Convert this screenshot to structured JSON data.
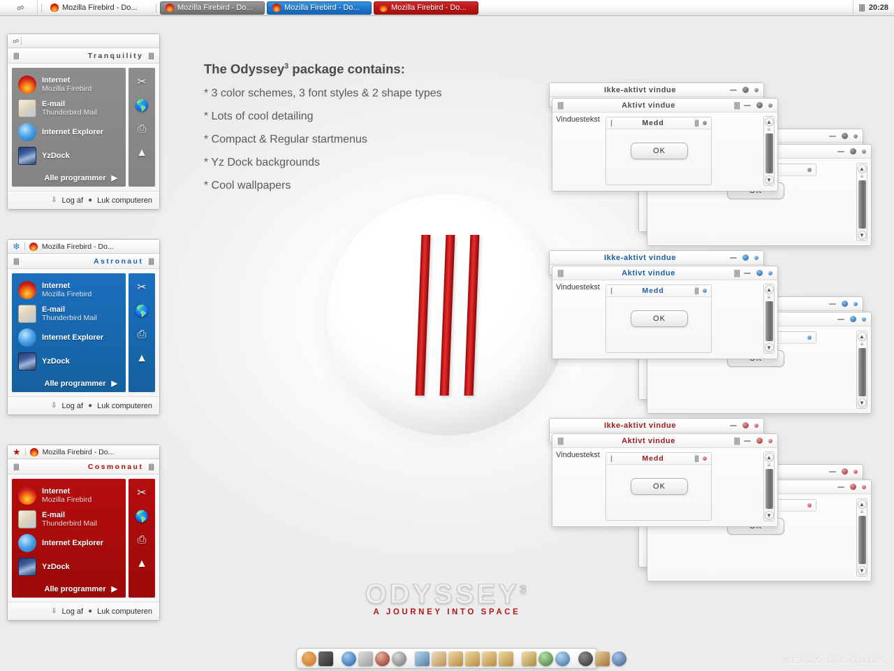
{
  "taskbar": {
    "start_icon": "infinity-icon",
    "tasks": [
      {
        "label": "Mozilla Firebird - Do...",
        "style": "plain",
        "icon": "firebird-icon"
      },
      {
        "label": "Mozilla Firebird - Do...",
        "style": "grey",
        "icon": "firebird-icon"
      },
      {
        "label": "Mozilla Firebird - Do...",
        "style": "blue",
        "icon": "firebird-icon"
      },
      {
        "label": "Mozilla Firebird - Do...",
        "style": "red",
        "icon": "firebird-icon"
      }
    ],
    "clock": "20:28",
    "clock_grip": "||||"
  },
  "startmenus": [
    {
      "theme": "grey",
      "tab_icon": "infinity-icon",
      "tab_label": "",
      "title": "Tranquility",
      "grip_left": "||||",
      "grip_right": "||||",
      "items": [
        {
          "title": "Internet",
          "sub": "Mozilla Firebird",
          "icon": "firefox-icon"
        },
        {
          "title": "E-mail",
          "sub": "Thunderbird Mail",
          "icon": "mail-icon"
        },
        {
          "title": "Internet Explorer",
          "sub": "",
          "icon": "ie-icon"
        },
        {
          "title": "YzDock",
          "sub": "",
          "icon": "yzdock-icon"
        }
      ],
      "all_programs": "Alle programmer",
      "all_programs_arrow": "▶",
      "side_icons": [
        "tools-icon",
        "globe-icon",
        "printer-icon",
        "eject-icon"
      ],
      "footer": {
        "logoff": "Log af",
        "shutdown": "Luk computeren"
      }
    },
    {
      "theme": "blue",
      "tab_icon": "snowflake-icon",
      "tab_label": "Mozilla Firebird - Do...",
      "title": "Astronaut",
      "grip_left": "||||",
      "grip_right": "||||",
      "items": [
        {
          "title": "Internet",
          "sub": "Mozilla Firebird",
          "icon": "firefox-icon"
        },
        {
          "title": "E-mail",
          "sub": "Thunderbird Mail",
          "icon": "mail-icon"
        },
        {
          "title": "Internet Explorer",
          "sub": "",
          "icon": "ie-icon"
        },
        {
          "title": "YzDock",
          "sub": "",
          "icon": "yzdock-icon"
        }
      ],
      "all_programs": "Alle programmer",
      "all_programs_arrow": "▶",
      "side_icons": [
        "tools-icon",
        "globe-icon",
        "printer-icon",
        "eject-icon"
      ],
      "footer": {
        "logoff": "Log af",
        "shutdown": "Luk computeren"
      }
    },
    {
      "theme": "red",
      "tab_icon": "star-icon",
      "tab_label": "Mozilla Firebird - Do...",
      "title": "Cosmonaut",
      "grip_left": "||||",
      "grip_right": "||||",
      "items": [
        {
          "title": "Internet",
          "sub": "Mozilla Firebird",
          "icon": "firefox-icon"
        },
        {
          "title": "E-mail",
          "sub": "Thunderbird Mail",
          "icon": "mail-icon"
        },
        {
          "title": "Internet Explorer",
          "sub": "",
          "icon": "ie-icon"
        },
        {
          "title": "YzDock",
          "sub": "",
          "icon": "yzdock-icon"
        }
      ],
      "all_programs": "Alle programmer",
      "all_programs_arrow": "▶",
      "side_icons": [
        "tools-icon",
        "globe-icon",
        "printer-icon",
        "eject-icon"
      ],
      "footer": {
        "logoff": "Log af",
        "shutdown": "Luk computeren"
      }
    }
  ],
  "promo": {
    "heading_before": "The Odyssey",
    "heading_sup": "3",
    "heading_after": " package contains:",
    "bullets": [
      "* 3 color schemes, 3 font styles & 2 shape types",
      "* Lots of cool detailing",
      "* Compact & Regular startmenus",
      "* Yz Dock backgrounds",
      "* Cool wallpapers"
    ]
  },
  "orb": {
    "bar_count": 3,
    "bar_color": "#c81414"
  },
  "logo": {
    "title": "ODYSSEY",
    "sup": "3",
    "tagline": "A JOURNEY INTO SPACE"
  },
  "window_groups": [
    {
      "theme": "grey",
      "inactive_title": "Ikke-aktivt vindue",
      "active_title": "Aktivt vindue",
      "window_text": "Vinduestekst",
      "dialog_title": "Medd",
      "dialog_grip_left": "|",
      "dialog_grip_right": "|||",
      "ok_label": "OK",
      "grip": "||||",
      "scroll_up": "▲",
      "scroll_down": "▼",
      "scroll_grip": "≡"
    },
    {
      "theme": "blue",
      "inactive_title": "Ikke-aktivt vindue",
      "active_title": "Aktivt vindue",
      "window_text": "Vinduestekst",
      "dialog_title": "Medd",
      "dialog_grip_left": "|",
      "dialog_grip_right": "|||",
      "ok_label": "OK",
      "grip": "||||",
      "scroll_up": "▲",
      "scroll_down": "▼",
      "scroll_grip": "≡"
    },
    {
      "theme": "red",
      "inactive_title": "Ikke-aktivt vindue",
      "active_title": "Aktivt vindue",
      "window_text": "Vinduestekst",
      "dialog_title": "Medd",
      "dialog_grip_left": "|",
      "dialog_grip_right": "|||",
      "ok_label": "OK",
      "grip": "||||",
      "scroll_up": "▲",
      "scroll_down": "▼",
      "scroll_grip": "≡"
    }
  ],
  "dock": {
    "icons": [
      "browser-icon",
      "notebook-icon",
      "SEP",
      "pen-icon",
      "disk-icon",
      "font-icon",
      "smiley-icon",
      "SEP",
      "monitor-icon",
      "mailbox-icon",
      "folder-icon",
      "folder2-icon",
      "folder3-icon",
      "folder4-icon",
      "SEP",
      "paint-icon",
      "media-icon",
      "globe2-icon",
      "SEP",
      "speaker-icon",
      "photo-icon",
      "world-icon"
    ]
  },
  "watermark": "NEXUS DIGITALIS",
  "colors": {
    "accent_grey": "#848484",
    "accent_blue": "#15619f",
    "accent_red": "#9d0a0a",
    "bar_red": "#c81414"
  }
}
